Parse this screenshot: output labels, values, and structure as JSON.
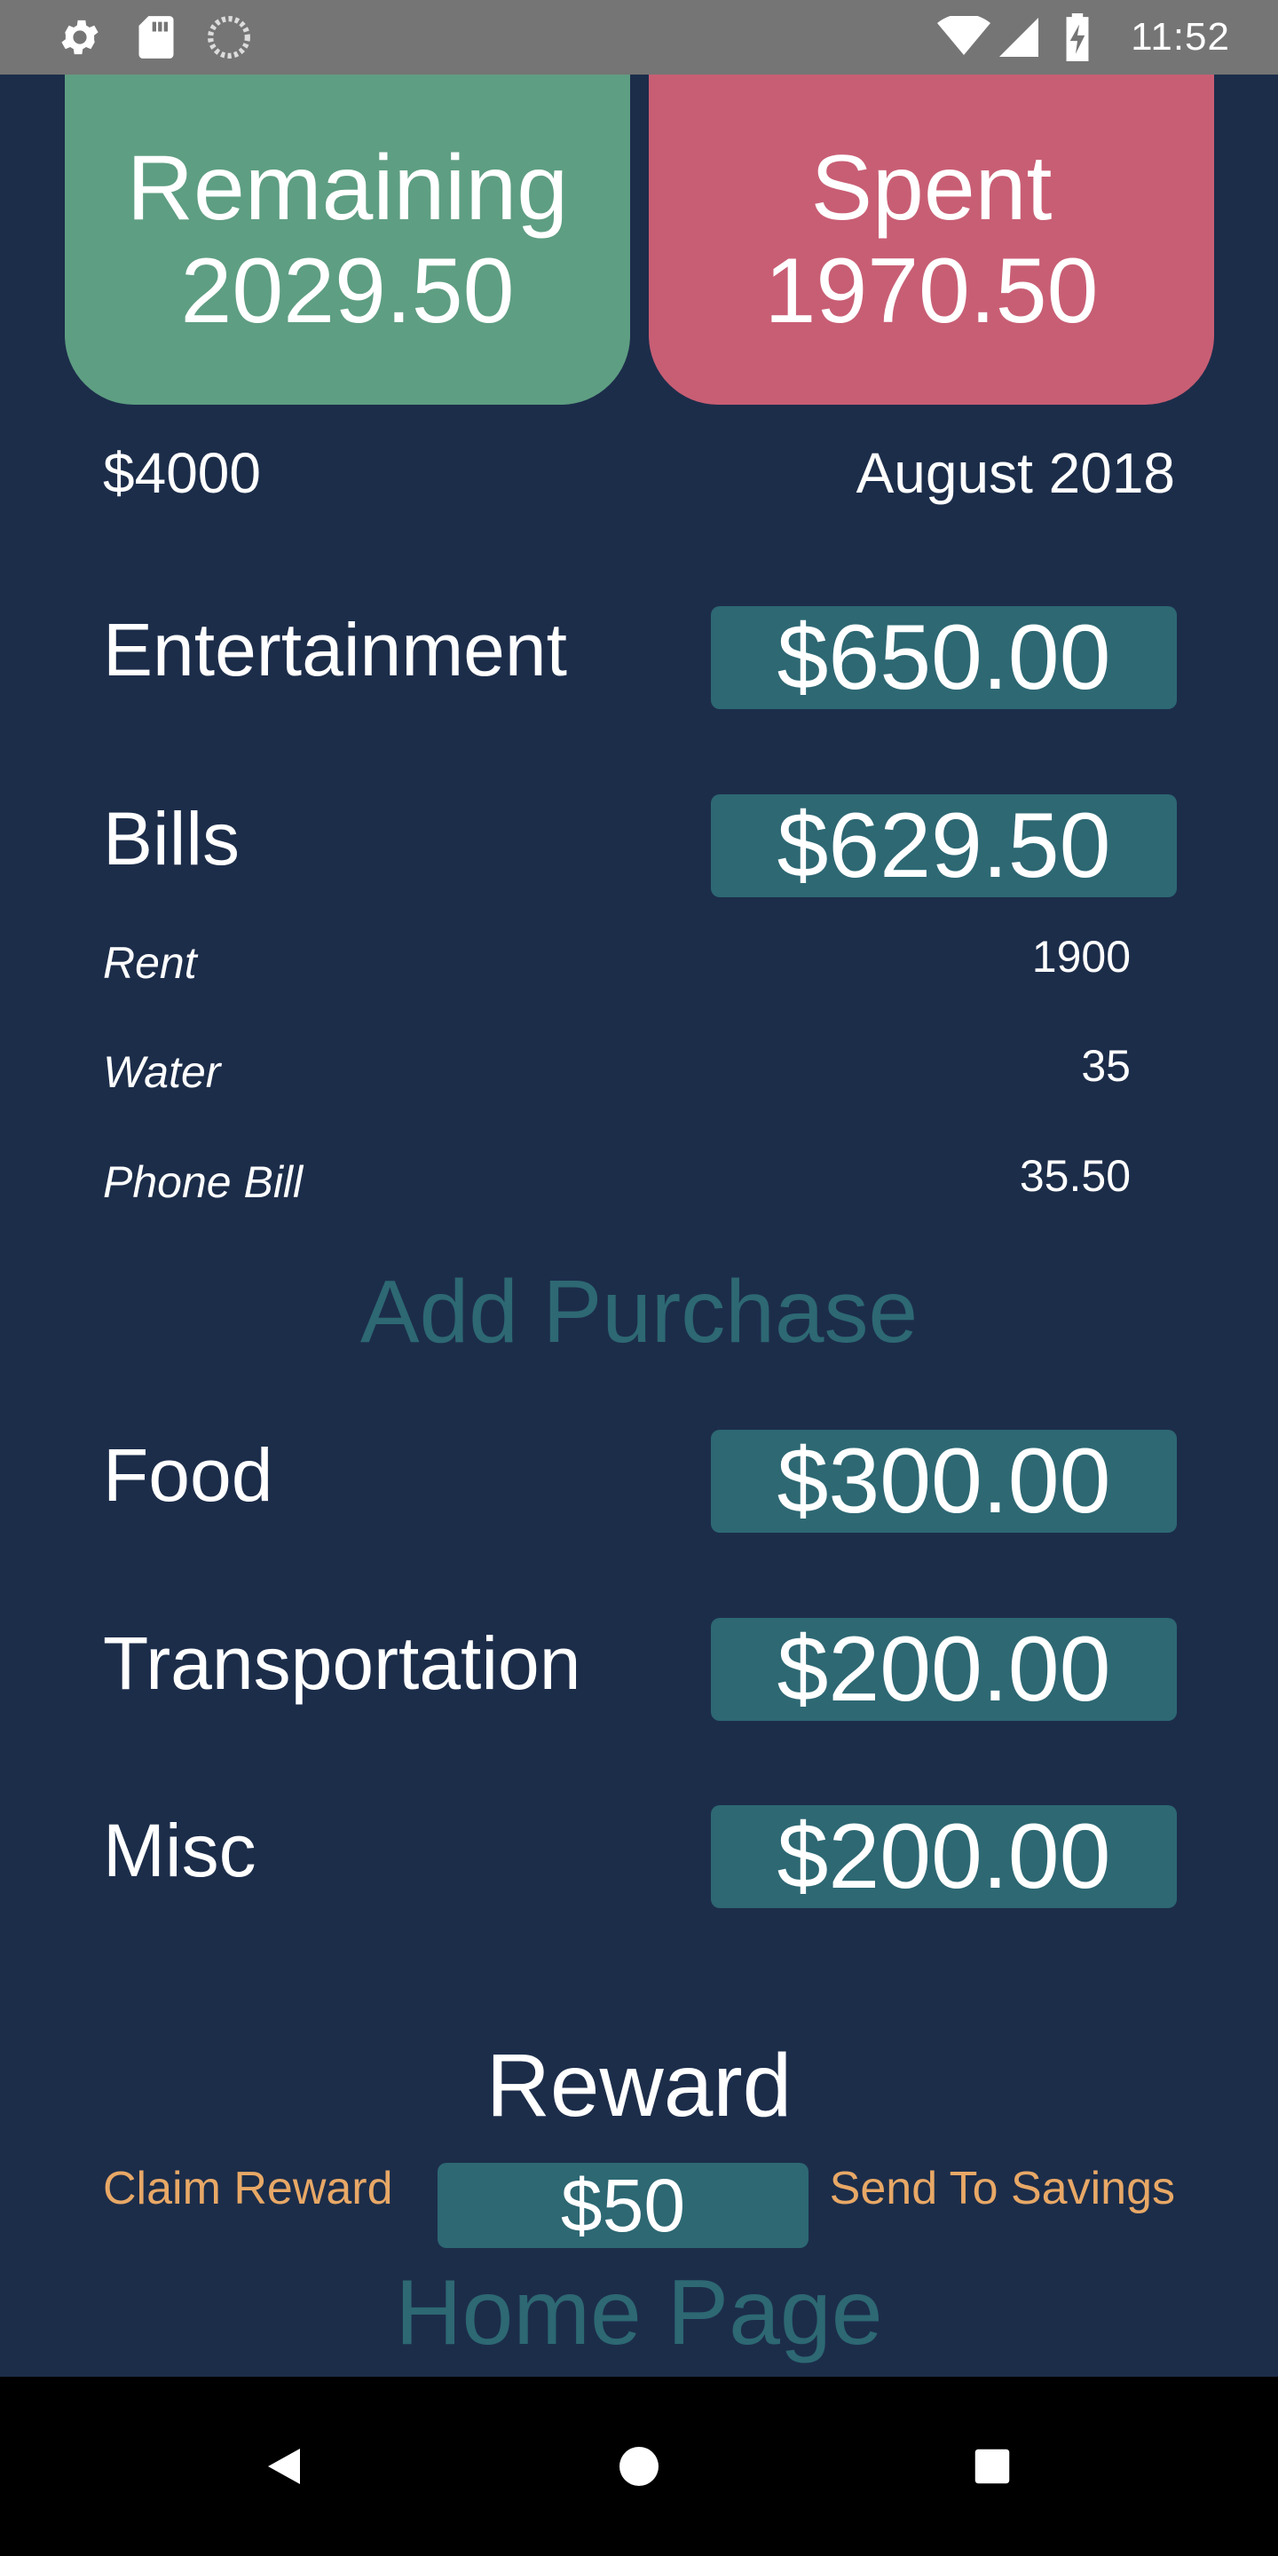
{
  "status_bar": {
    "time": "11:52",
    "icons_left": [
      "settings-icon",
      "sd-card-icon",
      "sync-icon"
    ],
    "icons_right": [
      "wifi-icon",
      "signal-icon",
      "battery-charging-icon"
    ]
  },
  "summary": {
    "remaining_label": "Remaining",
    "remaining_value": "2029.50",
    "spent_label": "Spent",
    "spent_value": "1970.50",
    "budget_total": "$4000",
    "month": "August 2018"
  },
  "categories": [
    {
      "label": "Entertainment",
      "amount": "$650.00"
    },
    {
      "label": "Bills",
      "amount": "$629.50"
    },
    {
      "label": "Food",
      "amount": "$300.00"
    },
    {
      "label": "Transportation",
      "amount": "$200.00"
    },
    {
      "label": "Misc",
      "amount": "$200.00"
    }
  ],
  "bills": [
    {
      "name": "Rent",
      "value": "1900"
    },
    {
      "name": "Water",
      "value": "35"
    },
    {
      "name": "Phone Bill",
      "value": "35.50"
    }
  ],
  "add_purchase_label": "Add Purchase",
  "reward": {
    "title": "Reward",
    "claim_label": "Claim Reward",
    "amount": "$50",
    "savings_label": "Send To Savings"
  },
  "home_page_label": "Home Page",
  "nav": [
    "back-icon",
    "home-icon",
    "recents-icon"
  ],
  "colors": {
    "background": "#1c2d4a",
    "remaining_card": "#5e9e82",
    "spent_card": "#c85e74",
    "amount_box": "#2d6873",
    "accent_link": "#e8a866"
  }
}
